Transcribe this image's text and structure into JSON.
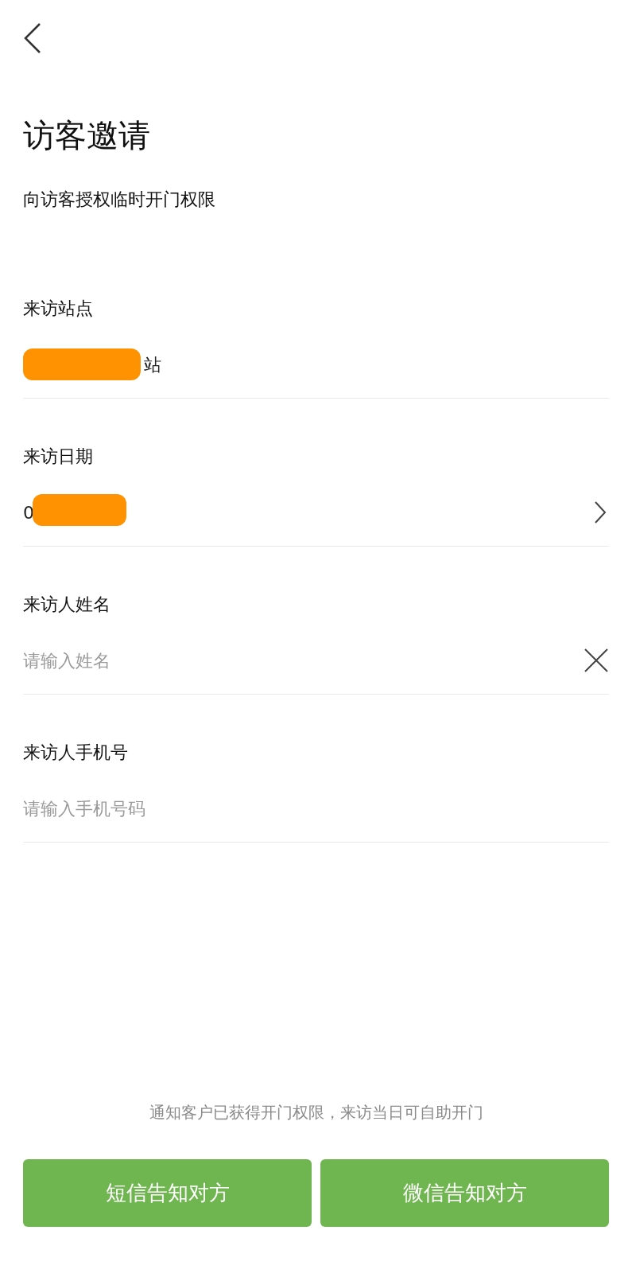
{
  "title": "访客邀请",
  "subtitle": "向访客授权临时开门权限",
  "fields": [
    {
      "kind": "display",
      "label": "来访站点",
      "value": "站",
      "redacted": true
    },
    {
      "kind": "picker",
      "label": "来访日期",
      "value": "0",
      "redacted": true
    },
    {
      "kind": "input",
      "label": "来访人姓名",
      "placeholder": "请输入姓名",
      "clearable": true
    },
    {
      "kind": "input",
      "label": "来访人手机号",
      "placeholder": "请输入手机号码",
      "clearable": false
    }
  ],
  "note": "通知客户已获得开门权限，来访当日可自助开门",
  "buttons": [
    "短信告知对方",
    "微信告知对方"
  ]
}
